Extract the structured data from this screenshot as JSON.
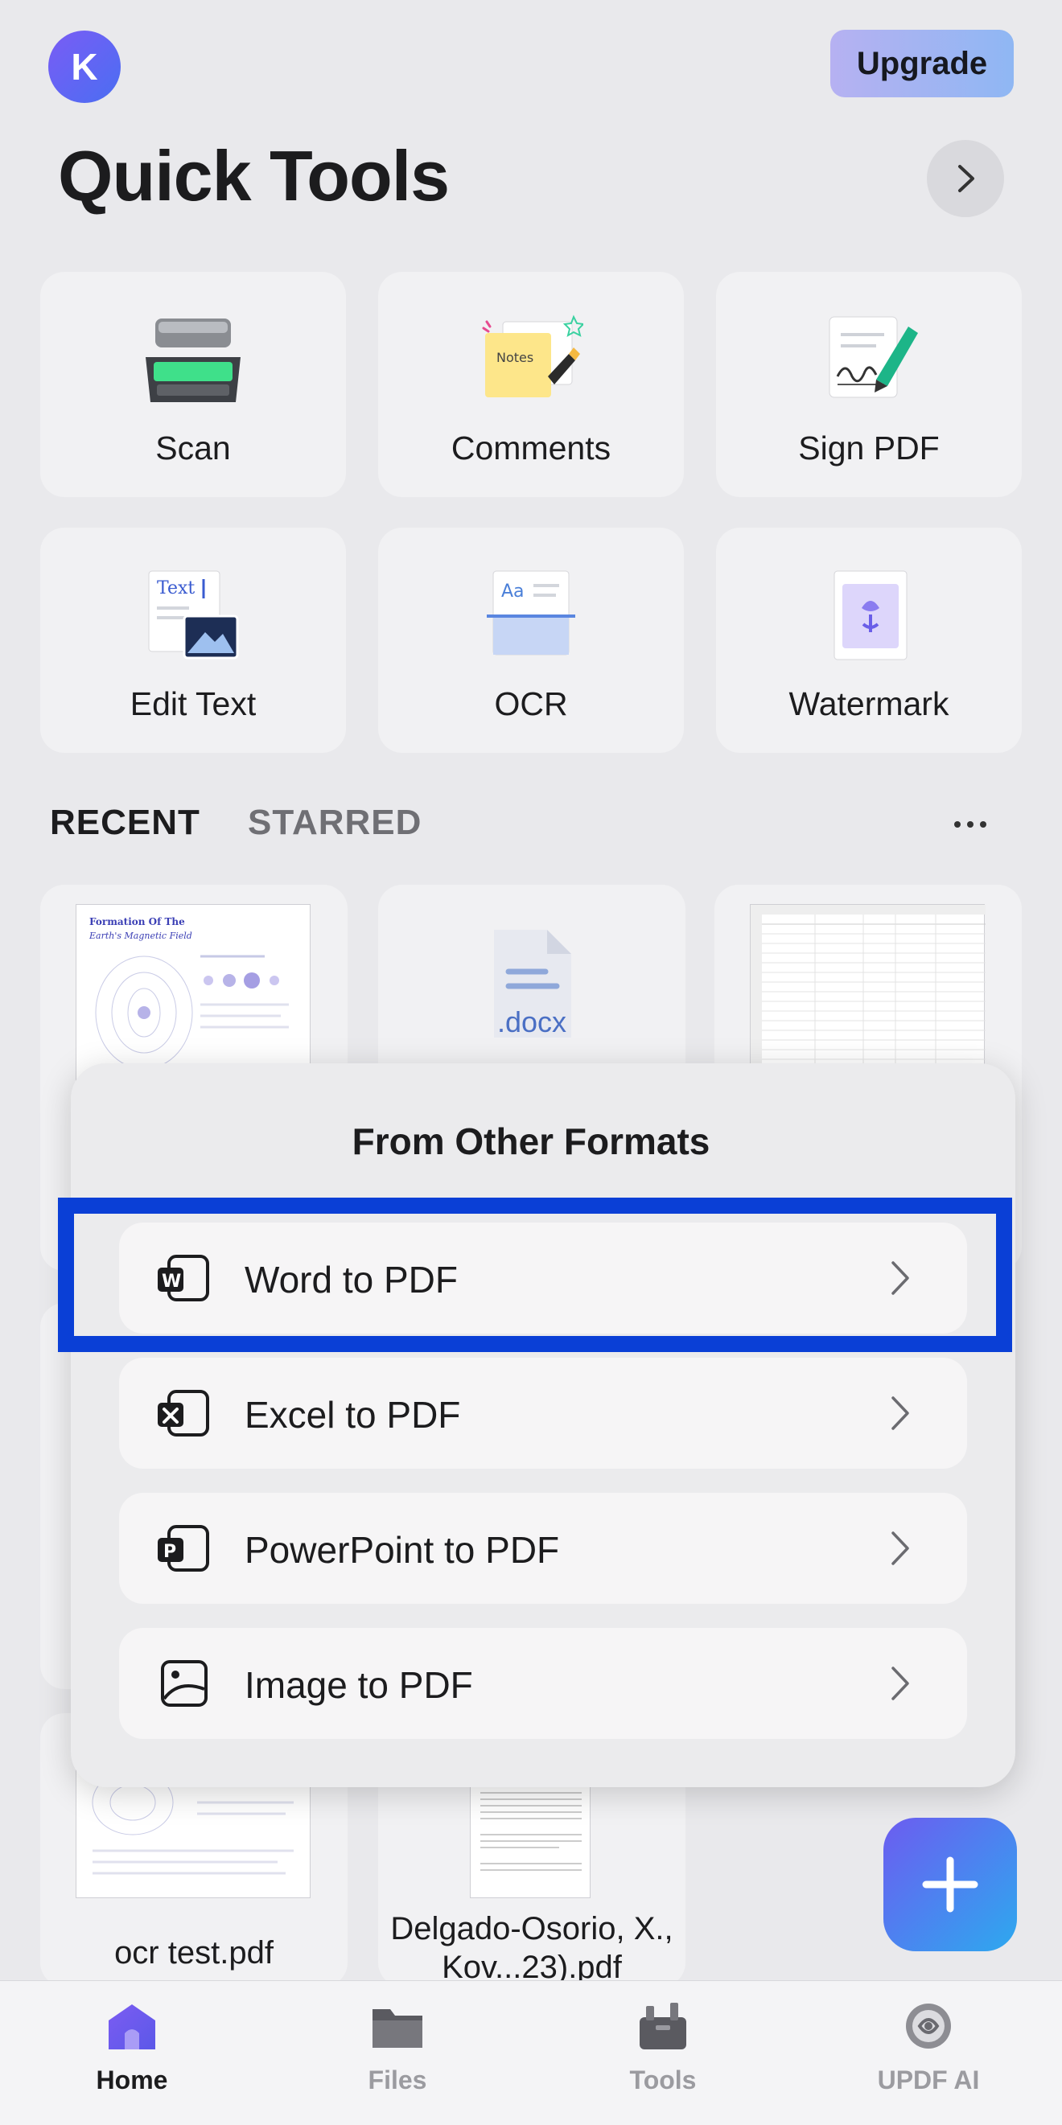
{
  "header": {
    "avatar_initial": "K",
    "upgrade_label": "Upgrade",
    "title": "Quick Tools"
  },
  "tools": [
    {
      "label": "Scan",
      "icon": "scanner-icon"
    },
    {
      "label": "Comments",
      "icon": "notes-icon"
    },
    {
      "label": "Sign PDF",
      "icon": "signature-pen-icon"
    },
    {
      "label": "Edit Text",
      "icon": "edit-text-icon"
    },
    {
      "label": "OCR",
      "icon": "ocr-icon"
    },
    {
      "label": "Watermark",
      "icon": "watermark-icon"
    }
  ],
  "tabs": {
    "recent": "RECENT",
    "starred": "STARRED"
  },
  "recent_files": [
    {
      "thumb_title": "Formation Of The",
      "thumb_subtitle": "Earth's Magnetic Field"
    },
    {
      "badge": ".docx"
    },
    {
      "thumb_type": "spreadsheet"
    },
    {
      "name": "ocr test.pdf"
    },
    {
      "name": "Delgado-Osorio, X., Kov...23).pdf"
    }
  ],
  "sheet": {
    "title": "From Other Formats",
    "options": [
      {
        "label": "Word to PDF",
        "icon": "word-doc-icon",
        "glyph": "W"
      },
      {
        "label": "Excel to PDF",
        "icon": "excel-doc-icon",
        "glyph": "X"
      },
      {
        "label": "PowerPoint to PDF",
        "icon": "powerpoint-doc-icon",
        "glyph": "P"
      },
      {
        "label": "Image to PDF",
        "icon": "image-doc-icon",
        "glyph": ""
      }
    ],
    "highlight_color": "#0a3fd6"
  },
  "nav": {
    "items": [
      {
        "label": "Home",
        "icon": "home-icon",
        "active": true
      },
      {
        "label": "Files",
        "icon": "folder-icon",
        "active": false
      },
      {
        "label": "Tools",
        "icon": "toolbox-icon",
        "active": false
      },
      {
        "label": "UPDF AI",
        "icon": "ai-icon",
        "active": false
      }
    ]
  },
  "colors": {
    "accent": "#4a6ef2",
    "fab_gradient_start": "#6c5cf0",
    "fab_gradient_end": "#2da9ef"
  }
}
